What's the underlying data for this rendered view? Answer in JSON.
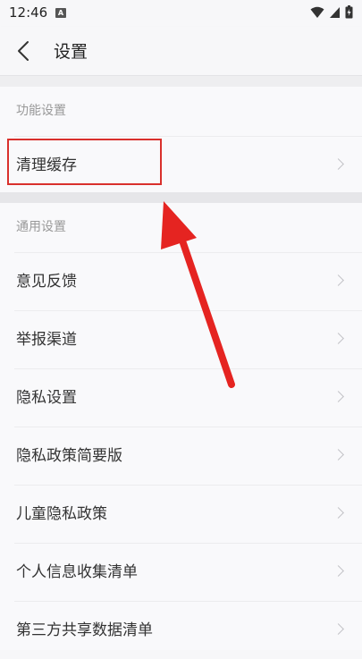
{
  "status_bar": {
    "time": "12:46",
    "notification_letter": "A",
    "icons": [
      "wifi-icon",
      "signal-icon",
      "battery-icon"
    ]
  },
  "header": {
    "title": "设置",
    "back_icon": "chevron-left-icon"
  },
  "sections": [
    {
      "title": "功能设置",
      "items": [
        {
          "label": "清理缓存"
        }
      ]
    },
    {
      "title": "通用设置",
      "items": [
        {
          "label": "意见反馈"
        },
        {
          "label": "举报渠道"
        },
        {
          "label": "隐私设置"
        },
        {
          "label": "隐私政策简要版"
        },
        {
          "label": "儿童隐私政策"
        },
        {
          "label": "个人信息收集清单"
        },
        {
          "label": "第三方共享数据清单"
        }
      ]
    }
  ],
  "annotation": {
    "color": "#e52421",
    "target": "清理缓存"
  },
  "colors": {
    "background": "#f7f7f9",
    "text": "#333333",
    "section_title": "#999999",
    "highlight": "#d9302c"
  }
}
